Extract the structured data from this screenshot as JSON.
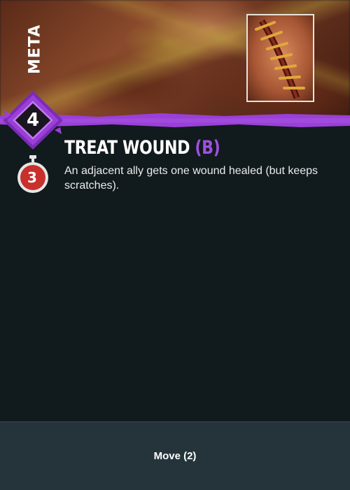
{
  "card": {
    "category": "META",
    "cost": "4",
    "timer": "3",
    "title": "TREAT WOUND",
    "title_tag": "(B)",
    "description": "An adjacent ally gets one wound healed (but keeps scratches).",
    "footer_label": "Move (2)"
  },
  "colors": {
    "background": "#111a1d",
    "accent_purple": "#a24fe0",
    "timer_red": "#c8302c",
    "footer_bg": "#25343b"
  },
  "icons": {
    "thumbnail": "stitched-wound-icon",
    "cost": "purple-diamond-badge",
    "timer": "stopwatch-icon"
  }
}
